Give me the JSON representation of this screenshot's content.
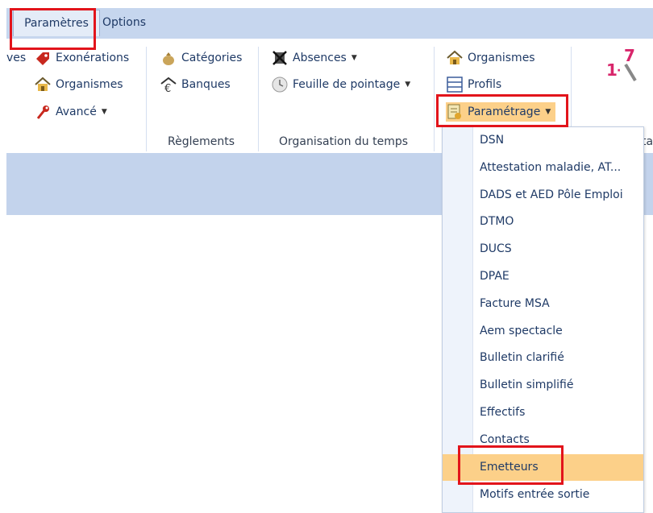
{
  "tabs": {
    "parametres": "Paramètres",
    "options": "Options"
  },
  "ribbon": {
    "col1": {
      "partial_left": "ves",
      "exonerations": "Exonérations",
      "organismes": "Organismes",
      "avance": "Avancé"
    },
    "col2": {
      "categories": "Catégories",
      "banques": "Banques",
      "group_label": "Règlements"
    },
    "col3": {
      "absences": "Absences",
      "feuille": "Feuille de pointage",
      "group_label": "Organisation du temps"
    },
    "col4": {
      "organismes": "Organismes",
      "profils": "Profils",
      "parametrage": "Paramétrage"
    },
    "numbering_icon_text": "1..7",
    "partial_right_label": "ta"
  },
  "menu": {
    "items": [
      "DSN",
      "Attestation maladie, AT...",
      "DADS et AED Pôle Emploi",
      "DTMO",
      "DUCS",
      "DPAE",
      "Facture MSA",
      "Aem spectacle",
      "Bulletin clarifié",
      "Bulletin simplifié",
      "Effectifs",
      "Contacts",
      "Emetteurs",
      "Motifs entrée sortie"
    ],
    "selected": "Emetteurs"
  },
  "colors": {
    "highlight_red": "#e2141b",
    "menu_selected": "#fcd089",
    "ribbon_blue": "#c3d3ec"
  }
}
